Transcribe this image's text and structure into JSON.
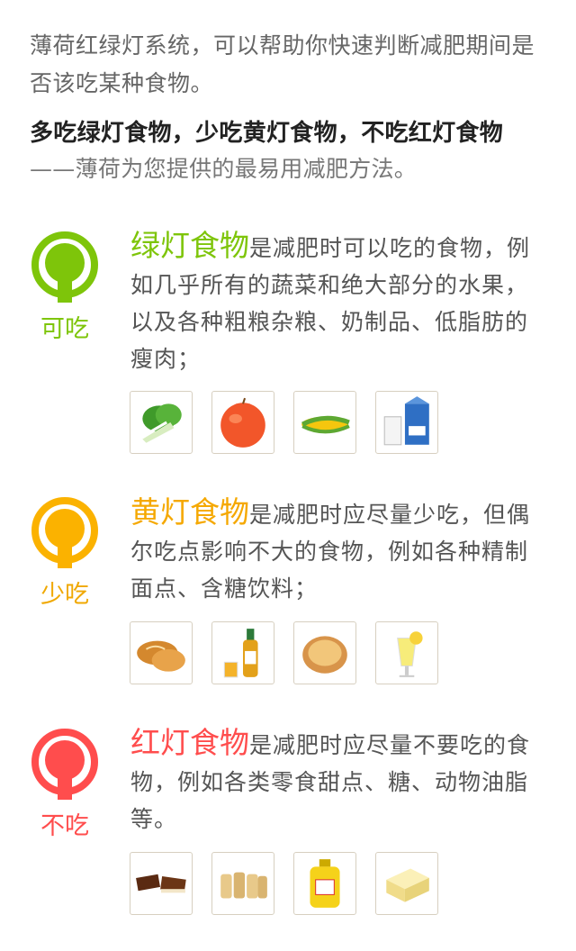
{
  "intro": "薄荷红绿灯系统，可以帮助你快速判断减肥期间是否该吃某种食物。",
  "tagline": "多吃绿灯食物，少吃黄灯食物，不吃红灯食物",
  "subtitle": "——薄荷为您提供的最易用减肥方法。",
  "sections": [
    {
      "color": "#7ec50a",
      "label": "可吃",
      "title": "绿灯食物",
      "desc": "是减肥时可以吃的食物，例如几乎所有的蔬菜和绝大部分的水果，以及各种粗粮杂粮、奶制品、低脂肪的瘦肉；",
      "foods": [
        "bok-choy-icon",
        "apple-icon",
        "corn-icon",
        "milk-icon"
      ]
    },
    {
      "color": "#fbb200",
      "label": "少吃",
      "title": "黄灯食物",
      "desc": "是减肥时应尽量少吃，但偶尔吃点影响不大的食物，例如各种精制面点、含糖饮料；",
      "foods": [
        "bread-icon",
        "beer-icon",
        "pastry-icon",
        "juice-icon"
      ]
    },
    {
      "color": "#ff4d4d",
      "label": "不吃",
      "title": "红灯食物",
      "desc": "是减肥时应尽量不要吃的食物，例如各类零食甜点、糖、动物油脂等。",
      "foods": [
        "chocolate-icon",
        "spring-roll-icon",
        "oil-bottle-icon",
        "butter-icon"
      ]
    }
  ]
}
